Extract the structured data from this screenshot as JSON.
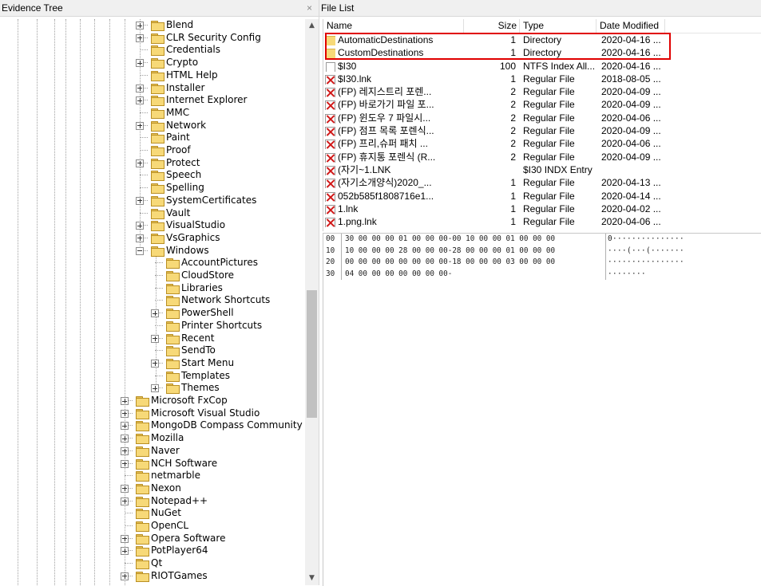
{
  "evidence_tree": {
    "title": "Evidence Tree",
    "close_glyph": "×",
    "nodes": [
      {
        "label": "Blend",
        "expandable": true,
        "expanded": false
      },
      {
        "label": "CLR Security Config",
        "expandable": true,
        "expanded": false
      },
      {
        "label": "Credentials",
        "expandable": false
      },
      {
        "label": "Crypto",
        "expandable": true,
        "expanded": false
      },
      {
        "label": "HTML Help",
        "expandable": false
      },
      {
        "label": "Installer",
        "expandable": true,
        "expanded": false
      },
      {
        "label": "Internet Explorer",
        "expandable": true,
        "expanded": false
      },
      {
        "label": "MMC",
        "expandable": false
      },
      {
        "label": "Network",
        "expandable": true,
        "expanded": false
      },
      {
        "label": "Paint",
        "expandable": false
      },
      {
        "label": "Proof",
        "expandable": false
      },
      {
        "label": "Protect",
        "expandable": true,
        "expanded": false
      },
      {
        "label": "Speech",
        "expandable": false
      },
      {
        "label": "Spelling",
        "expandable": false
      },
      {
        "label": "SystemCertificates",
        "expandable": true,
        "expanded": false
      },
      {
        "label": "Vault",
        "expandable": false
      },
      {
        "label": "VisualStudio",
        "expandable": true,
        "expanded": false
      },
      {
        "label": "VsGraphics",
        "expandable": true,
        "expanded": false
      },
      {
        "label": "Windows",
        "expandable": true,
        "expanded": true
      },
      {
        "label": "AccountPictures",
        "expandable": false
      },
      {
        "label": "CloudStore",
        "expandable": false
      },
      {
        "label": "Libraries",
        "expandable": false
      },
      {
        "label": "Network Shortcuts",
        "expandable": false
      },
      {
        "label": "PowerShell",
        "expandable": true,
        "expanded": false
      },
      {
        "label": "Printer Shortcuts",
        "expandable": false
      },
      {
        "label": "Recent",
        "expandable": true,
        "expanded": false
      },
      {
        "label": "SendTo",
        "expandable": false
      },
      {
        "label": "Start Menu",
        "expandable": true,
        "expanded": false
      },
      {
        "label": "Templates",
        "expandable": false
      },
      {
        "label": "Themes",
        "expandable": true,
        "expanded": false
      },
      {
        "label": "Microsoft FxCop",
        "expandable": true,
        "expanded": false
      },
      {
        "label": "Microsoft Visual Studio",
        "expandable": true,
        "expanded": false
      },
      {
        "label": "MongoDB Compass Community",
        "expandable": true,
        "expanded": false
      },
      {
        "label": "Mozilla",
        "expandable": true,
        "expanded": false
      },
      {
        "label": "Naver",
        "expandable": true,
        "expanded": false
      },
      {
        "label": "NCH Software",
        "expandable": true,
        "expanded": false
      },
      {
        "label": "netmarble",
        "expandable": false
      },
      {
        "label": "Nexon",
        "expandable": true,
        "expanded": false
      },
      {
        "label": "Notepad++",
        "expandable": true,
        "expanded": false
      },
      {
        "label": "NuGet",
        "expandable": false
      },
      {
        "label": "OpenCL",
        "expandable": false
      },
      {
        "label": "Opera Software",
        "expandable": true,
        "expanded": false
      },
      {
        "label": "PotPlayer64",
        "expandable": true,
        "expanded": false
      },
      {
        "label": "Qt",
        "expandable": false
      },
      {
        "label": "RIOTGames",
        "expandable": true,
        "expanded": false
      }
    ]
  },
  "file_list": {
    "title": "File List",
    "columns": {
      "name": "Name",
      "size": "Size",
      "type": "Type",
      "date": "Date Modified"
    },
    "rows": [
      {
        "icon": "folder-icon",
        "name": "AutomaticDestinations",
        "size": "1",
        "type": "Directory",
        "date": "2020-04-16 ..."
      },
      {
        "icon": "folder-icon",
        "name": "CustomDestinations",
        "size": "1",
        "type": "Directory",
        "date": "2020-04-16 ..."
      },
      {
        "icon": "file-icon",
        "name": "$I30",
        "size": "100",
        "type": "NTFS Index All...",
        "date": "2020-04-16 ..."
      },
      {
        "icon": "deleted-file-icon",
        "name": "$I30.lnk",
        "size": "1",
        "type": "Regular File",
        "date": "2018-08-05 ..."
      },
      {
        "icon": "deleted-file-icon",
        "name": "(FP) 레지스트리 포렌...",
        "size": "2",
        "type": "Regular File",
        "date": "2020-04-09 ..."
      },
      {
        "icon": "deleted-file-icon",
        "name": "(FP) 바로가기 파일 포...",
        "size": "2",
        "type": "Regular File",
        "date": "2020-04-09 ..."
      },
      {
        "icon": "deleted-file-icon",
        "name": "(FP) 윈도우 7 파일시...",
        "size": "2",
        "type": "Regular File",
        "date": "2020-04-06 ..."
      },
      {
        "icon": "deleted-file-icon",
        "name": "(FP) 점프 목록 포렌식...",
        "size": "2",
        "type": "Regular File",
        "date": "2020-04-09 ..."
      },
      {
        "icon": "deleted-file-icon",
        "name": "(FP) 프리,슈퍼 패치 ...",
        "size": "2",
        "type": "Regular File",
        "date": "2020-04-06 ..."
      },
      {
        "icon": "deleted-file-icon",
        "name": "(FP) 휴지통 포렌식 (R...",
        "size": "2",
        "type": "Regular File",
        "date": "2020-04-09 ..."
      },
      {
        "icon": "deleted-file-icon",
        "name": "(자기~1.LNK",
        "size": "",
        "type": "$I30 INDX Entry",
        "date": ""
      },
      {
        "icon": "deleted-file-icon",
        "name": "(자기소개양식)2020_...",
        "size": "1",
        "type": "Regular File",
        "date": "2020-04-13 ..."
      },
      {
        "icon": "deleted-file-icon",
        "name": "052b585f1808716e1...",
        "size": "1",
        "type": "Regular File",
        "date": "2020-04-14 ..."
      },
      {
        "icon": "deleted-file-icon",
        "name": "1.lnk",
        "size": "1",
        "type": "Regular File",
        "date": "2020-04-02 ..."
      },
      {
        "icon": "deleted-file-icon",
        "name": "1.png.lnk",
        "size": "1",
        "type": "Regular File",
        "date": "2020-04-06 ..."
      }
    ]
  },
  "hex_view": {
    "lines": [
      {
        "offset": "00",
        "bytes": "30 00 00 00 01 00 00 00-00 10 00 00 01 00 00 00",
        "ascii": "0···············"
      },
      {
        "offset": "10",
        "bytes": "10 00 00 00 28 00 00 00-28 00 00 00 01 00 00 00",
        "ascii": "····(···(·······"
      },
      {
        "offset": "20",
        "bytes": "00 00 00 00 00 00 00 00-18 00 00 00 03 00 00 00",
        "ascii": "················"
      },
      {
        "offset": "30",
        "bytes": "04 00 00 00 00 00 00 00-",
        "ascii": "········"
      }
    ]
  },
  "colors": {
    "highlight": "#e00000",
    "folder": "#f7d978",
    "deleted_mark": "#d01818"
  }
}
